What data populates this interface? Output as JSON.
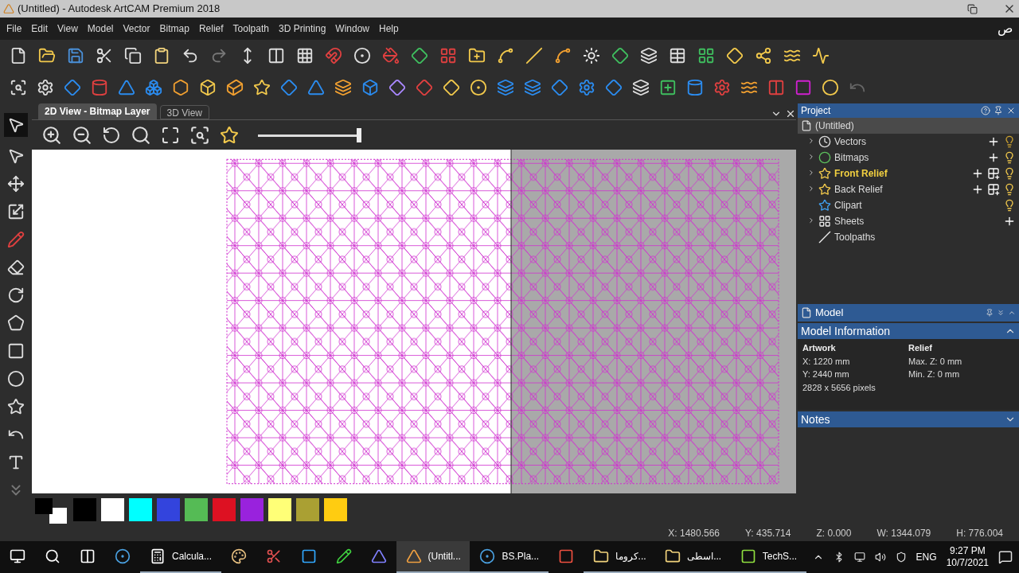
{
  "window": {
    "title": "(Untitled) - Autodesk ArtCAM Premium 2018"
  },
  "menu": [
    "File",
    "Edit",
    "View",
    "Model",
    "Vector",
    "Bitmap",
    "Relief",
    "Toolpath",
    "3D Printing",
    "Window",
    "Help"
  ],
  "menu_extra": "ص",
  "view_tabs": [
    {
      "label": "2D View - Bitmap Layer",
      "selected": true
    },
    {
      "label": "3D View",
      "selected": false
    }
  ],
  "zoom_slider": {
    "level": 1
  },
  "project": {
    "title": "Project",
    "root": "(Untitled)",
    "items": [
      {
        "label": "Vectors",
        "kind": "group",
        "expanded": false,
        "selected": false
      },
      {
        "label": "Bitmaps",
        "kind": "group",
        "expanded": false,
        "selected": false
      },
      {
        "label": "Front Relief",
        "kind": "group",
        "expanded": false,
        "selected": true
      },
      {
        "label": "Back Relief",
        "kind": "group",
        "expanded": false,
        "selected": false
      },
      {
        "label": "Clipart",
        "kind": "leaf",
        "selected": false
      },
      {
        "label": "Sheets",
        "kind": "group",
        "expanded": false,
        "selected": false
      },
      {
        "label": "Toolpaths",
        "kind": "leaf",
        "selected": false
      }
    ]
  },
  "model_panel": {
    "title": "Model",
    "sections": [
      {
        "title": "Model Information",
        "expanded": true,
        "columns": [
          {
            "heading": "Artwork",
            "lines": [
              "X: 1220 mm",
              "Y: 2440 mm",
              "2828 x 5656 pixels"
            ]
          },
          {
            "heading": "Relief",
            "lines": [
              "Max. Z: 0 mm",
              "Min. Z: 0 mm"
            ]
          }
        ]
      },
      {
        "title": "Notes",
        "expanded": false
      }
    ]
  },
  "palette": {
    "current_colors": [
      {
        "color": "#000000"
      },
      {
        "color": "#ffffff"
      }
    ],
    "swatches": [
      {
        "color": "#000000"
      },
      {
        "color": "#ffffff"
      },
      {
        "color": "#00ffff"
      },
      {
        "color": "#3344dd"
      },
      {
        "color": "#55bb55"
      },
      {
        "color": "#dd1122"
      },
      {
        "color": "#9922dd"
      },
      {
        "color": "#ffff77"
      },
      {
        "color": "#aaa033"
      },
      {
        "color": "#ffcc11"
      }
    ]
  },
  "status_bar": [
    "X: 1480.566",
    "Y: 435.714",
    "Z: 0.000",
    "W: 1344.079",
    "H: 776.004"
  ],
  "taskbar": {
    "items": [
      {
        "kind": "start",
        "open": false
      },
      {
        "kind": "search",
        "open": false
      },
      {
        "kind": "taskview",
        "open": false
      },
      {
        "kind": "bs",
        "open": false
      },
      {
        "kind": "calc",
        "label": "Calcula...",
        "open": true
      },
      {
        "kind": "paint",
        "open": false
      },
      {
        "kind": "snip",
        "open": false
      },
      {
        "kind": "ps",
        "open": false
      },
      {
        "kind": "green",
        "open": false
      },
      {
        "kind": "artcam_old",
        "open": false
      },
      {
        "kind": "artcam",
        "label": "(Untitl...",
        "open": true,
        "selected": true
      },
      {
        "kind": "bs",
        "label": "BS.Pla...",
        "open": true,
        "selected": false
      },
      {
        "kind": "camtasia",
        "open": false
      },
      {
        "kind": "folder",
        "label": "كروما...",
        "open": true
      },
      {
        "kind": "folder",
        "label": "اسطى...",
        "open": true
      },
      {
        "kind": "techsmith",
        "label": "TechS...",
        "open": true
      }
    ],
    "tray": {
      "language": "ENG",
      "time": "9:27 PM",
      "date": "10/7/2021"
    }
  }
}
